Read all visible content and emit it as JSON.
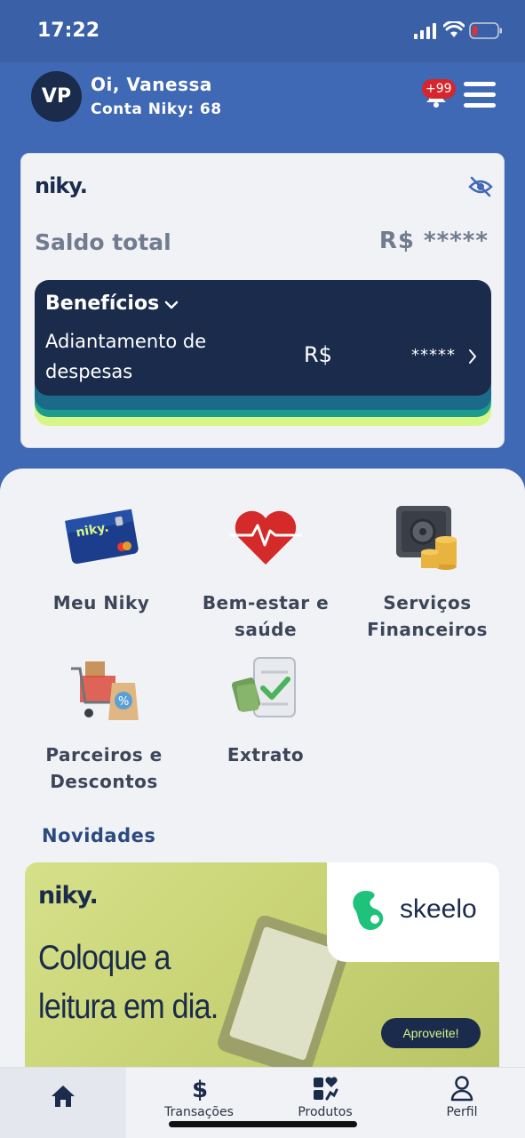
{
  "status_bar": {
    "time": "17:22"
  },
  "header": {
    "avatar_initials": "VP",
    "greeting": "Oi, Vanessa",
    "account": "Conta Niky: 68",
    "notification_badge": "+99"
  },
  "balance_card": {
    "logo": "niky.",
    "label": "Saldo total",
    "value_masked": "R$ *****",
    "benefits": {
      "title": "Benefícios",
      "description": "Adiantamento de despesas",
      "currency": "R$",
      "masked": "*****"
    }
  },
  "services": [
    {
      "label": "Meu Niky",
      "icon": "niky-card-icon"
    },
    {
      "label": "Bem-estar e saúde",
      "icon": "heart-pulse-icon"
    },
    {
      "label": "Serviços Financeiros",
      "icon": "safe-coins-icon"
    },
    {
      "label": "Parceiros e Descontos",
      "icon": "shopping-cart-icon"
    },
    {
      "label": "Extrato",
      "icon": "receipt-money-icon"
    }
  ],
  "news": {
    "title": "Novidades",
    "banner": {
      "logo": "niky.",
      "headline_line1": "Coloque a",
      "headline_line2": "leitura em dia.",
      "partner": "skeelo",
      "cta": "Aproveite!"
    }
  },
  "bottom_nav": [
    {
      "label": "",
      "icon": "home-icon",
      "active": true
    },
    {
      "label": "Transações",
      "icon": "dollar-icon"
    },
    {
      "label": "Produtos",
      "icon": "products-icon"
    },
    {
      "label": "Perfil",
      "icon": "user-icon"
    }
  ],
  "colors": {
    "header_blue": "#3f68b5",
    "navy": "#1a2b4c",
    "panel": "#f1f2f6",
    "accent_green": "#d7f688",
    "badge_red": "#d8252b"
  }
}
